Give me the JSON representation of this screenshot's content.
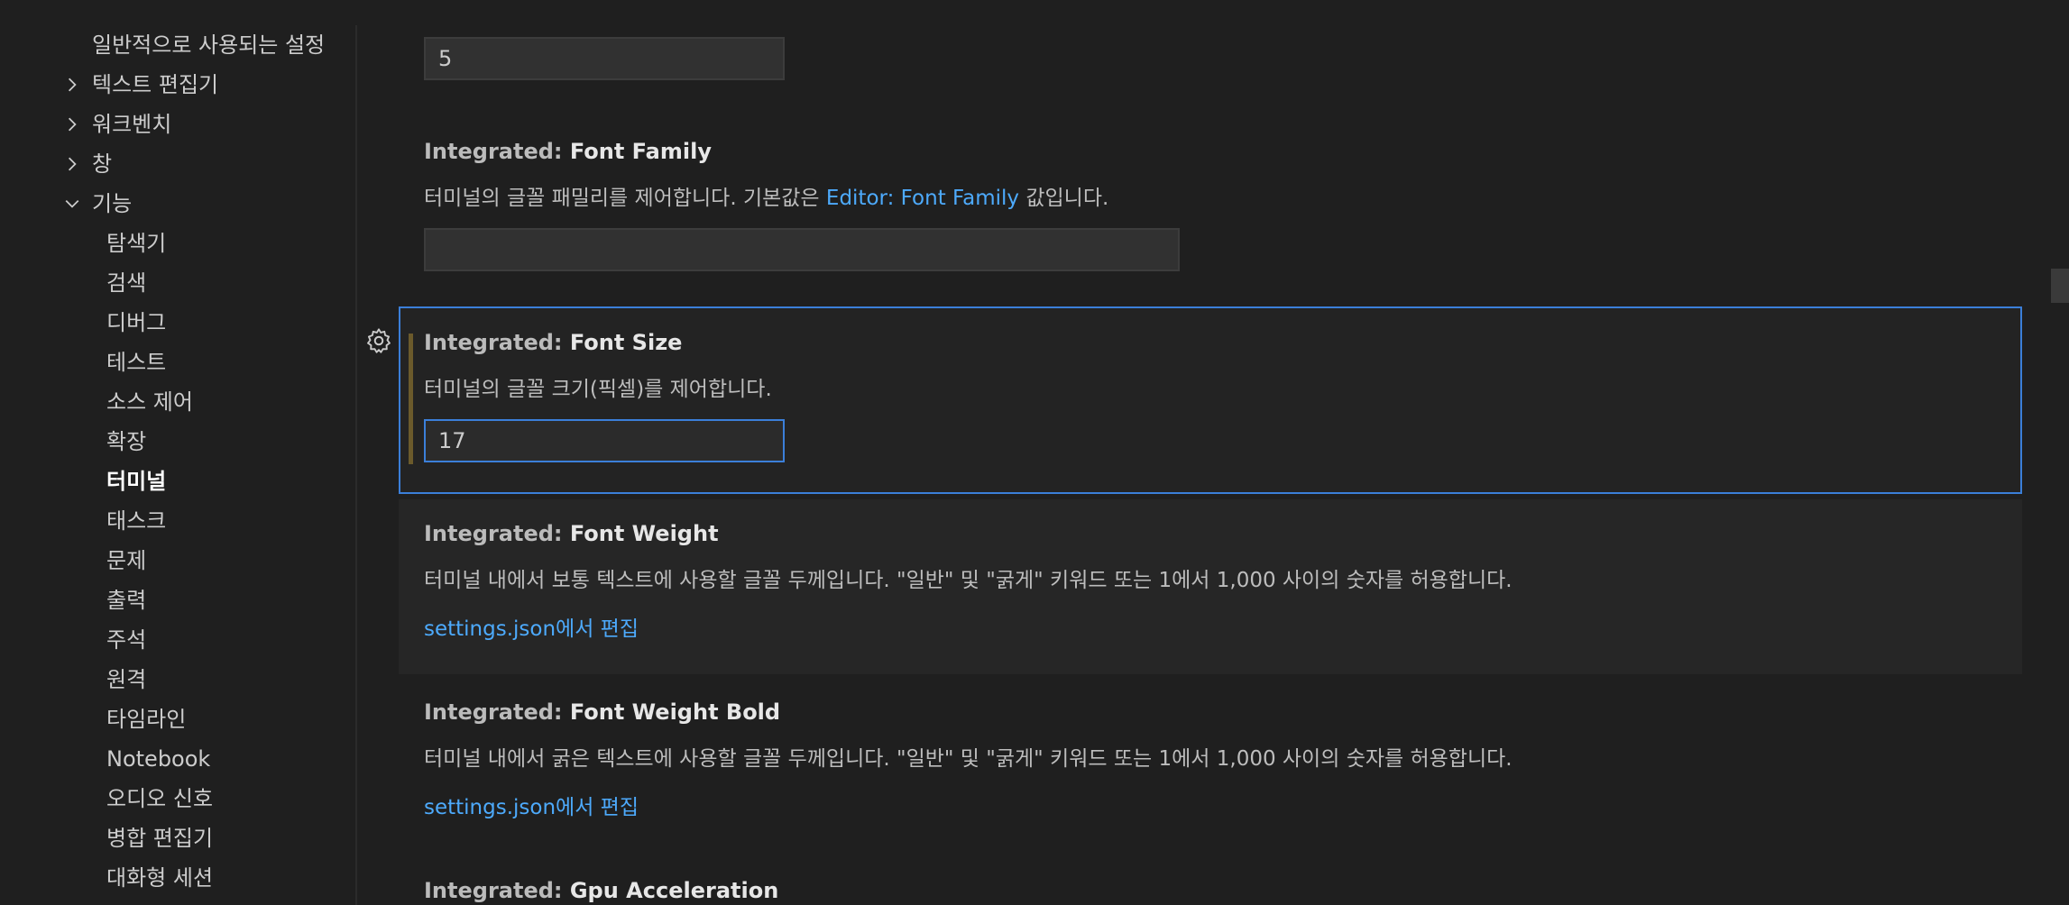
{
  "sidebar": {
    "items": [
      {
        "label": "일반적으로 사용되는 설정",
        "chevron": "none"
      },
      {
        "label": "텍스트 편집기",
        "chevron": "right"
      },
      {
        "label": "워크벤치",
        "chevron": "right"
      },
      {
        "label": "창",
        "chevron": "right"
      },
      {
        "label": "기능",
        "chevron": "down"
      },
      {
        "label": "탐색기"
      },
      {
        "label": "검색"
      },
      {
        "label": "디버그"
      },
      {
        "label": "테스트"
      },
      {
        "label": "소스 제어"
      },
      {
        "label": "확장"
      },
      {
        "label": "터미널",
        "active": true
      },
      {
        "label": "태스크"
      },
      {
        "label": "문제"
      },
      {
        "label": "출력"
      },
      {
        "label": "주석"
      },
      {
        "label": "원격"
      },
      {
        "label": "타임라인"
      },
      {
        "label": "Notebook"
      },
      {
        "label": "오디오 신호"
      },
      {
        "label": "병합 편집기"
      },
      {
        "label": "대화형 세션"
      }
    ]
  },
  "settings": {
    "prev_value": "5",
    "font_family": {
      "category": "Integrated: ",
      "name": "Font Family",
      "desc_before": "터미널의 글꼴 패밀리를 제어합니다. 기본값은 ",
      "desc_link": "Editor: Font Family",
      "desc_after": " 값입니다.",
      "value": ""
    },
    "font_size": {
      "category": "Integrated: ",
      "name": "Font Size",
      "desc": "터미널의 글꼴 크기(픽셀)를 제어합니다.",
      "value": "17"
    },
    "font_weight": {
      "category": "Integrated: ",
      "name": "Font Weight",
      "desc": "터미널 내에서 보통 텍스트에 사용할 글꼴 두께입니다. \"일반\" 및 \"굵게\" 키워드 또는 1에서 1,000 사이의 숫자를 허용합니다.",
      "link": "settings.json에서 편집"
    },
    "font_weight_bold": {
      "category": "Integrated: ",
      "name": "Font Weight Bold",
      "desc": "터미널 내에서 굵은 텍스트에 사용할 글꼴 두께입니다. \"일반\" 및 \"굵게\" 키워드 또는 1에서 1,000 사이의 숫자를 허용합니다.",
      "link": "settings.json에서 편집"
    },
    "gpu_acceleration": {
      "category": "Integrated: ",
      "name": "Gpu Acceleration"
    }
  },
  "icons": {
    "chevron_right": "chevron-right-icon",
    "chevron_down": "chevron-down-icon",
    "gear": "gear-icon"
  },
  "colors": {
    "focus_border": "#3b7fd9",
    "link": "#4daafc",
    "modified_indicator": "#6b5a2b"
  }
}
